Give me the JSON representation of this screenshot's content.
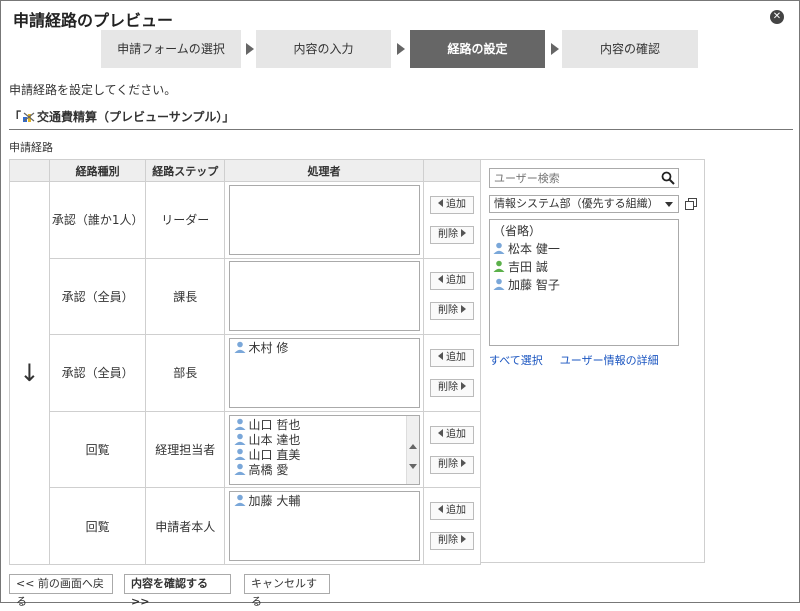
{
  "dialog": {
    "title": "申請経路のプレビュー"
  },
  "steps": [
    {
      "label": "申請フォームの選択",
      "active": false
    },
    {
      "label": "内容の入力",
      "active": false
    },
    {
      "label": "経路の設定",
      "active": true
    },
    {
      "label": "内容の確認",
      "active": false
    }
  ],
  "instruction": "申請経路を設定してください。",
  "form": {
    "open": "「",
    "name": "交通費精算（プレビューサンプル）",
    "close": "」"
  },
  "section_label": "申請経路",
  "table": {
    "headers": [
      "経路種別",
      "経路ステップ",
      "処理者"
    ],
    "flow_arrow": "↓",
    "rows": [
      {
        "type": "承認（誰か1人）",
        "step": "リーダー",
        "users": []
      },
      {
        "type": "承認（全員）",
        "step": "課長",
        "users": []
      },
      {
        "type": "承認（全員）",
        "step": "部長",
        "users": [
          "木村 修"
        ]
      },
      {
        "type": "回覧",
        "step": "経理担当者",
        "users": [
          "山口 哲也",
          "山本 達也",
          "山口 直美",
          "高橋 愛"
        ]
      },
      {
        "type": "回覧",
        "step": "申請者本人",
        "users": [
          "加藤 大輔"
        ]
      }
    ],
    "add_label": "追加",
    "remove_label": "削除"
  },
  "right": {
    "search_placeholder": "ユーザー検索",
    "org_selected": "情報システム部（優先する組織）",
    "list": [
      {
        "label": "（省略）",
        "icon": "none"
      },
      {
        "label": "松本 健一",
        "icon": "user-blue"
      },
      {
        "label": "吉田 誠",
        "icon": "user-green"
      },
      {
        "label": "加藤 智子",
        "icon": "user-blue"
      }
    ],
    "select_all": "すべて選択",
    "user_details": "ユーザー情報の詳細"
  },
  "footer": {
    "back": "<< 前の画面へ戻る",
    "confirm": "内容を確認する >>",
    "cancel": "キャンセルする"
  },
  "colors": {
    "active_step": "#666666",
    "link": "#1a55c0",
    "user_icon_blue": "#7aa7d9",
    "user_icon_green": "#5bb04a"
  }
}
